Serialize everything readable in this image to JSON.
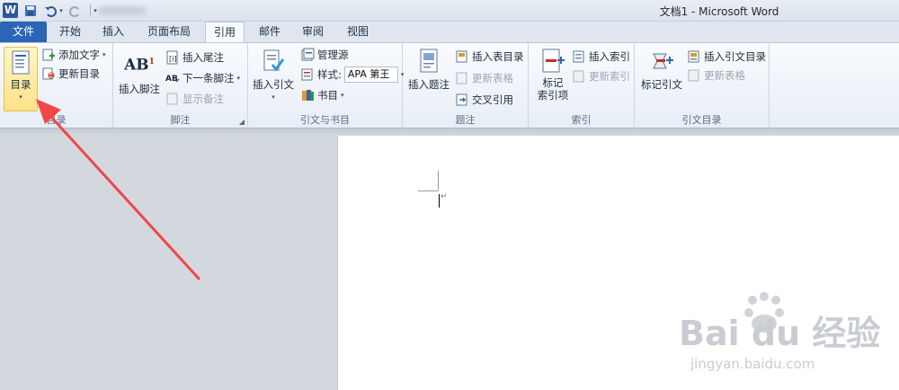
{
  "title_bar": {
    "app_icon_letter": "W",
    "document_title": "文档1 - Microsoft Word"
  },
  "tabs": [
    {
      "label": "文件"
    },
    {
      "label": "开始"
    },
    {
      "label": "插入"
    },
    {
      "label": "页面布局"
    },
    {
      "label": "引用"
    },
    {
      "label": "邮件"
    },
    {
      "label": "审阅"
    },
    {
      "label": "视图"
    }
  ],
  "ribbon": {
    "toc": {
      "group_label": "目录",
      "toc_button": "目录",
      "add_text": "添加文字",
      "update_toc": "更新目录"
    },
    "footnotes": {
      "group_label": "脚注",
      "insert_footnote": "插入脚注",
      "insert_endnote": "插入尾注",
      "next_footnote": "下一条脚注",
      "show_notes": "显示备注",
      "ab_glyph": "AB",
      "ab_sup": "1"
    },
    "citations": {
      "group_label": "引文与书目",
      "insert_citation": "插入引文",
      "manage_sources": "管理源",
      "style_label": "样式:",
      "style_value": "APA 第王",
      "bibliography": "书目"
    },
    "captions": {
      "group_label": "题注",
      "insert_caption": "插入题注",
      "insert_table_of_figures": "插入表目录",
      "update_table": "更新表格",
      "cross_reference": "交叉引用"
    },
    "index": {
      "group_label": "索引",
      "mark_entry_line1": "标记",
      "mark_entry_line2": "索引项",
      "insert_index": "插入索引",
      "update_index": "更新索引"
    },
    "toa": {
      "group_label": "引文目录",
      "mark_citation": "标记引文",
      "insert_toa": "插入引文目录",
      "update_table": "更新表格"
    }
  },
  "document": {
    "paragraph_mark": "↵"
  },
  "watermark": {
    "brand_text": "Bai du 经验",
    "url": "jingyan.baidu.com"
  },
  "colors": {
    "file_tab": "#2b65b5",
    "highlight_button": "#ffe18a",
    "annotation_arrow": "#f04747"
  }
}
